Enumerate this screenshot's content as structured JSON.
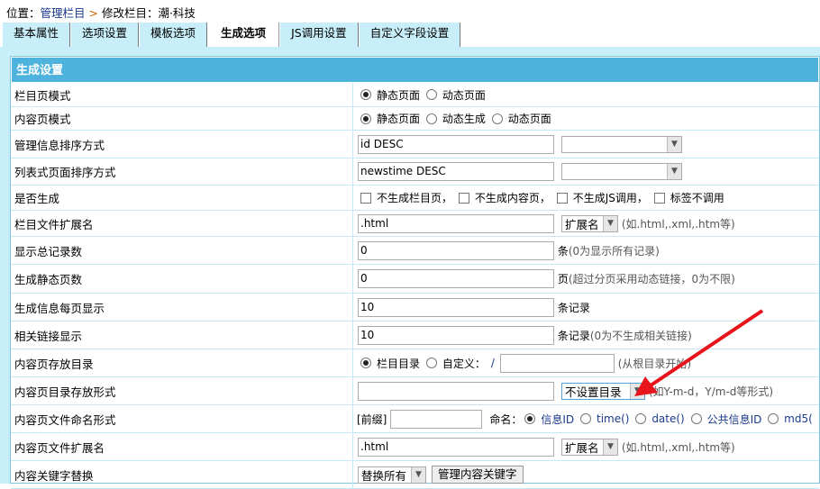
{
  "breadcrumb": {
    "prefix": "位置：",
    "link": "管理栏目",
    "sep": " > ",
    "current": "修改栏目：潮·科技"
  },
  "tabs": [
    "基本属性",
    "选项设置",
    "模板选项",
    "生成选项",
    "JS调用设置",
    "自定义字段设置"
  ],
  "active_tab": "生成选项",
  "section_title": "生成设置",
  "rows": {
    "list_mode": {
      "label": "栏目页模式",
      "options": [
        "静态页面",
        "动态页面"
      ],
      "selected": "静态页面"
    },
    "content_mode": {
      "label": "内容页模式",
      "options": [
        "静态页面",
        "动态生成",
        "动态页面"
      ],
      "selected": "静态页面"
    },
    "admin_order": {
      "label": "管理信息排序方式",
      "value": "id DESC",
      "select": ""
    },
    "list_order": {
      "label": "列表式页面排序方式",
      "value": "newstime DESC",
      "select": ""
    },
    "generate": {
      "label": "是否生成",
      "options": [
        "不生成栏目页，",
        "不生成内容页，",
        "不生成JS调用，",
        "标签不调用"
      ]
    },
    "list_ext": {
      "label": "栏目文件扩展名",
      "value": ".html",
      "select": "扩展名",
      "hint": "(如.html,.xml,.htm等)"
    },
    "total_records": {
      "label": "显示总记录数",
      "value": "0",
      "unit": "条",
      "hint": "(0为显示所有记录)"
    },
    "static_pages": {
      "label": "生成静态页数",
      "value": "0",
      "unit": "页",
      "hint": "(超过分页采用动态链接，0为不限)"
    },
    "per_page": {
      "label": "生成信息每页显示",
      "value": "10",
      "unit": "条记录"
    },
    "related": {
      "label": "相关链接显示",
      "value": "10",
      "unit": "条记录",
      "hint": "(0为不生成相关链接)"
    },
    "content_dir": {
      "label": "内容页存放目录",
      "options": [
        "栏目目录",
        "自定义："
      ],
      "selected": "栏目目录",
      "slash": "/",
      "value": "",
      "hint": "(从根目录开始)"
    },
    "dir_format": {
      "label": "内容页目录存放形式",
      "value": "",
      "select": "不设置目录",
      "hint": "(如Y-m-d，Y/m-d等形式)"
    },
    "naming": {
      "label": "内容页文件命名形式",
      "prefix_label": "[前缀]",
      "prefix_value": "",
      "name_label": "命名：",
      "options": [
        "信息ID",
        "time()",
        "date()",
        "公共信息ID",
        "md5("
      ],
      "selected": "信息ID"
    },
    "content_ext": {
      "label": "内容页文件扩展名",
      "value": ".html",
      "select": "扩展名",
      "hint": "(如.html,.xml,.htm等)"
    },
    "keyword": {
      "label": "内容关键字替换",
      "select": "替换所有",
      "button": "管理内容关键字"
    }
  },
  "colors": {
    "header": "#4eb3dc",
    "panel": "#c8eef9",
    "arrow": "#e8141c",
    "link": "#1a3a8c"
  }
}
